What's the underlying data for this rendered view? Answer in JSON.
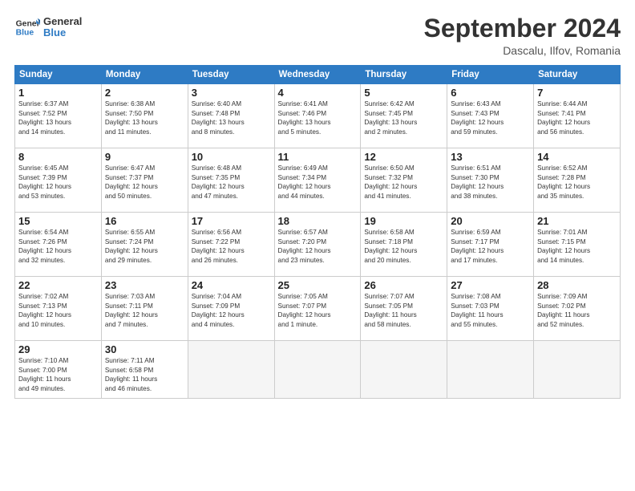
{
  "header": {
    "logo_line1": "General",
    "logo_line2": "Blue",
    "month_title": "September 2024",
    "subtitle": "Dascalu, Ilfov, Romania"
  },
  "weekdays": [
    "Sunday",
    "Monday",
    "Tuesday",
    "Wednesday",
    "Thursday",
    "Friday",
    "Saturday"
  ],
  "weeks": [
    [
      {
        "day": "1",
        "info": "Sunrise: 6:37 AM\nSunset: 7:52 PM\nDaylight: 13 hours\nand 14 minutes."
      },
      {
        "day": "2",
        "info": "Sunrise: 6:38 AM\nSunset: 7:50 PM\nDaylight: 13 hours\nand 11 minutes."
      },
      {
        "day": "3",
        "info": "Sunrise: 6:40 AM\nSunset: 7:48 PM\nDaylight: 13 hours\nand 8 minutes."
      },
      {
        "day": "4",
        "info": "Sunrise: 6:41 AM\nSunset: 7:46 PM\nDaylight: 13 hours\nand 5 minutes."
      },
      {
        "day": "5",
        "info": "Sunrise: 6:42 AM\nSunset: 7:45 PM\nDaylight: 13 hours\nand 2 minutes."
      },
      {
        "day": "6",
        "info": "Sunrise: 6:43 AM\nSunset: 7:43 PM\nDaylight: 12 hours\nand 59 minutes."
      },
      {
        "day": "7",
        "info": "Sunrise: 6:44 AM\nSunset: 7:41 PM\nDaylight: 12 hours\nand 56 minutes."
      }
    ],
    [
      {
        "day": "8",
        "info": "Sunrise: 6:45 AM\nSunset: 7:39 PM\nDaylight: 12 hours\nand 53 minutes."
      },
      {
        "day": "9",
        "info": "Sunrise: 6:47 AM\nSunset: 7:37 PM\nDaylight: 12 hours\nand 50 minutes."
      },
      {
        "day": "10",
        "info": "Sunrise: 6:48 AM\nSunset: 7:35 PM\nDaylight: 12 hours\nand 47 minutes."
      },
      {
        "day": "11",
        "info": "Sunrise: 6:49 AM\nSunset: 7:34 PM\nDaylight: 12 hours\nand 44 minutes."
      },
      {
        "day": "12",
        "info": "Sunrise: 6:50 AM\nSunset: 7:32 PM\nDaylight: 12 hours\nand 41 minutes."
      },
      {
        "day": "13",
        "info": "Sunrise: 6:51 AM\nSunset: 7:30 PM\nDaylight: 12 hours\nand 38 minutes."
      },
      {
        "day": "14",
        "info": "Sunrise: 6:52 AM\nSunset: 7:28 PM\nDaylight: 12 hours\nand 35 minutes."
      }
    ],
    [
      {
        "day": "15",
        "info": "Sunrise: 6:54 AM\nSunset: 7:26 PM\nDaylight: 12 hours\nand 32 minutes."
      },
      {
        "day": "16",
        "info": "Sunrise: 6:55 AM\nSunset: 7:24 PM\nDaylight: 12 hours\nand 29 minutes."
      },
      {
        "day": "17",
        "info": "Sunrise: 6:56 AM\nSunset: 7:22 PM\nDaylight: 12 hours\nand 26 minutes."
      },
      {
        "day": "18",
        "info": "Sunrise: 6:57 AM\nSunset: 7:20 PM\nDaylight: 12 hours\nand 23 minutes."
      },
      {
        "day": "19",
        "info": "Sunrise: 6:58 AM\nSunset: 7:18 PM\nDaylight: 12 hours\nand 20 minutes."
      },
      {
        "day": "20",
        "info": "Sunrise: 6:59 AM\nSunset: 7:17 PM\nDaylight: 12 hours\nand 17 minutes."
      },
      {
        "day": "21",
        "info": "Sunrise: 7:01 AM\nSunset: 7:15 PM\nDaylight: 12 hours\nand 14 minutes."
      }
    ],
    [
      {
        "day": "22",
        "info": "Sunrise: 7:02 AM\nSunset: 7:13 PM\nDaylight: 12 hours\nand 10 minutes."
      },
      {
        "day": "23",
        "info": "Sunrise: 7:03 AM\nSunset: 7:11 PM\nDaylight: 12 hours\nand 7 minutes."
      },
      {
        "day": "24",
        "info": "Sunrise: 7:04 AM\nSunset: 7:09 PM\nDaylight: 12 hours\nand 4 minutes."
      },
      {
        "day": "25",
        "info": "Sunrise: 7:05 AM\nSunset: 7:07 PM\nDaylight: 12 hours\nand 1 minute."
      },
      {
        "day": "26",
        "info": "Sunrise: 7:07 AM\nSunset: 7:05 PM\nDaylight: 11 hours\nand 58 minutes."
      },
      {
        "day": "27",
        "info": "Sunrise: 7:08 AM\nSunset: 7:03 PM\nDaylight: 11 hours\nand 55 minutes."
      },
      {
        "day": "28",
        "info": "Sunrise: 7:09 AM\nSunset: 7:02 PM\nDaylight: 11 hours\nand 52 minutes."
      }
    ],
    [
      {
        "day": "29",
        "info": "Sunrise: 7:10 AM\nSunset: 7:00 PM\nDaylight: 11 hours\nand 49 minutes."
      },
      {
        "day": "30",
        "info": "Sunrise: 7:11 AM\nSunset: 6:58 PM\nDaylight: 11 hours\nand 46 minutes."
      },
      {
        "day": "",
        "info": ""
      },
      {
        "day": "",
        "info": ""
      },
      {
        "day": "",
        "info": ""
      },
      {
        "day": "",
        "info": ""
      },
      {
        "day": "",
        "info": ""
      }
    ]
  ]
}
